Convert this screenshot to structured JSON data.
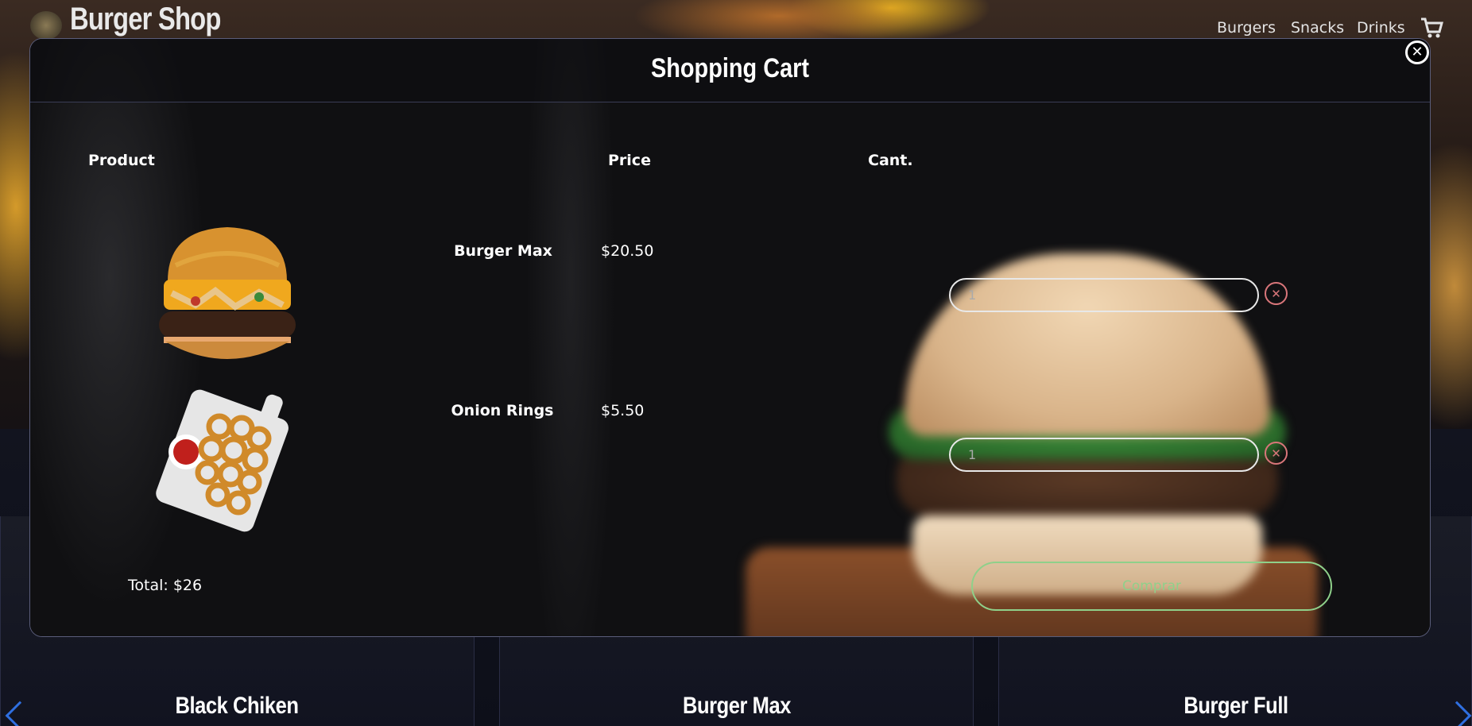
{
  "header": {
    "logo_text": "Burger Shop",
    "nav": [
      "Burgers",
      "Snacks",
      "Drinks"
    ],
    "cart_icon": "cart-icon"
  },
  "modal": {
    "title": "Shopping Cart",
    "close_icon": "close-icon",
    "columns": {
      "product": "Product",
      "price": "Price",
      "qty": "Cant."
    },
    "items": [
      {
        "name": "Burger Max",
        "price": "$20.50",
        "qty": "1",
        "image": "burger-image"
      },
      {
        "name": "Onion Rings",
        "price": "$5.50",
        "qty": "1",
        "image": "onion-rings-image"
      }
    ],
    "total": "Total: $26",
    "buy_label": "Comprar"
  },
  "background_cards": [
    "Black Chiken",
    "Burger Max",
    "Burger Full"
  ],
  "colors": {
    "buy_accent": "#8fd08a",
    "remove_accent": "#d9767a",
    "arrow_accent": "#2f6fe0"
  }
}
